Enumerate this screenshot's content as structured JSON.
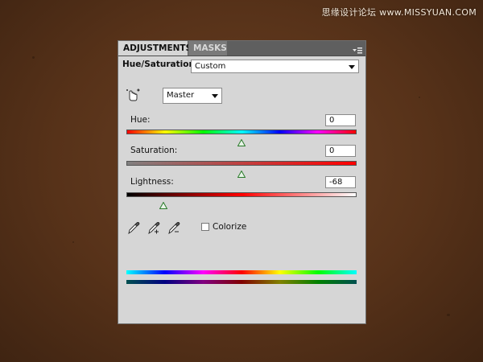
{
  "watermark": {
    "text": "思缘设计论坛 www.MISSYUAN.COM"
  },
  "panel": {
    "tabs": [
      {
        "label": "ADJUSTMENTS",
        "active": true
      },
      {
        "label": "MASKS",
        "active": false
      }
    ],
    "title": "Hue/Saturation",
    "preset": {
      "value": "Custom"
    },
    "channel": {
      "value": "Master"
    },
    "hue": {
      "label": "Hue:",
      "value": "0"
    },
    "saturation": {
      "label": "Saturation:",
      "value": "0"
    },
    "lightness": {
      "label": "Lightness:",
      "value": "-68"
    },
    "sliders": {
      "hue_position": 0.5,
      "saturation_position": 0.5,
      "lightness_position": 0.16
    },
    "colorize": {
      "label": "Colorize",
      "checked": false
    },
    "icons": {
      "panel_menu": "panel-menu-icon",
      "hand_adjust": "on-image-adjust-icon",
      "eyedropper": "eyedropper-icon",
      "eyedropper_add": "eyedropper-add-icon",
      "eyedropper_subtract": "eyedropper-subtract-icon"
    }
  }
}
